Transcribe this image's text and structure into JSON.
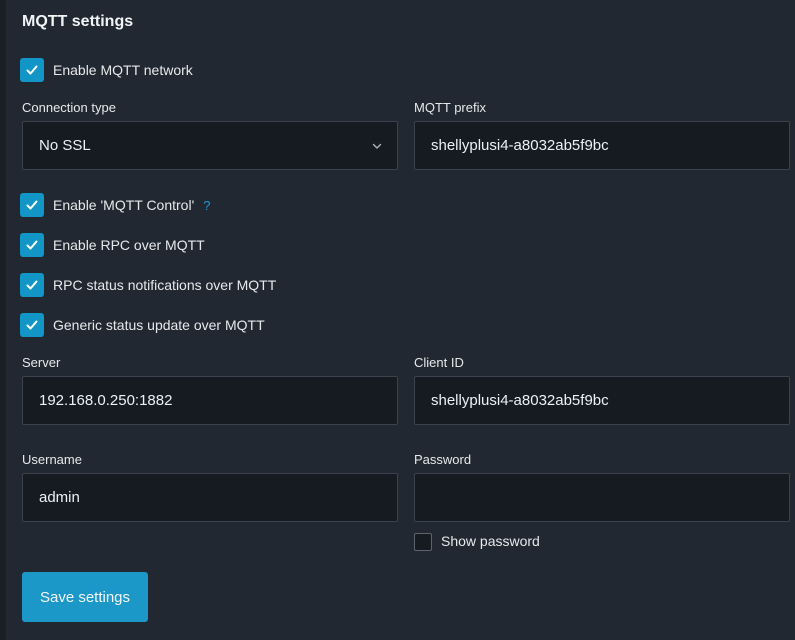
{
  "section": {
    "title": "MQTT settings"
  },
  "enable_mqtt": {
    "label": "Enable MQTT network",
    "checked": true
  },
  "connection_type": {
    "label": "Connection type",
    "value": "No SSL"
  },
  "mqtt_prefix": {
    "label": "MQTT prefix",
    "value": "shellyplusi4-a8032ab5f9bc"
  },
  "options": [
    {
      "label": "Enable 'MQTT Control'",
      "checked": true,
      "help": "?"
    },
    {
      "label": "Enable RPC over MQTT",
      "checked": true
    },
    {
      "label": "RPC status notifications over MQTT",
      "checked": true
    },
    {
      "label": "Generic status update over MQTT",
      "checked": true
    }
  ],
  "server": {
    "label": "Server",
    "value": "192.168.0.250:1882"
  },
  "client_id": {
    "label": "Client ID",
    "value": "shellyplusi4-a8032ab5f9bc"
  },
  "username": {
    "label": "Username",
    "value": "admin"
  },
  "password": {
    "label": "Password",
    "value": ""
  },
  "show_password": {
    "label": "Show password",
    "checked": false
  },
  "save_button": {
    "label": "Save settings"
  },
  "colors": {
    "accent": "#1296c7",
    "background": "#222831",
    "input_bg": "#161b22"
  }
}
